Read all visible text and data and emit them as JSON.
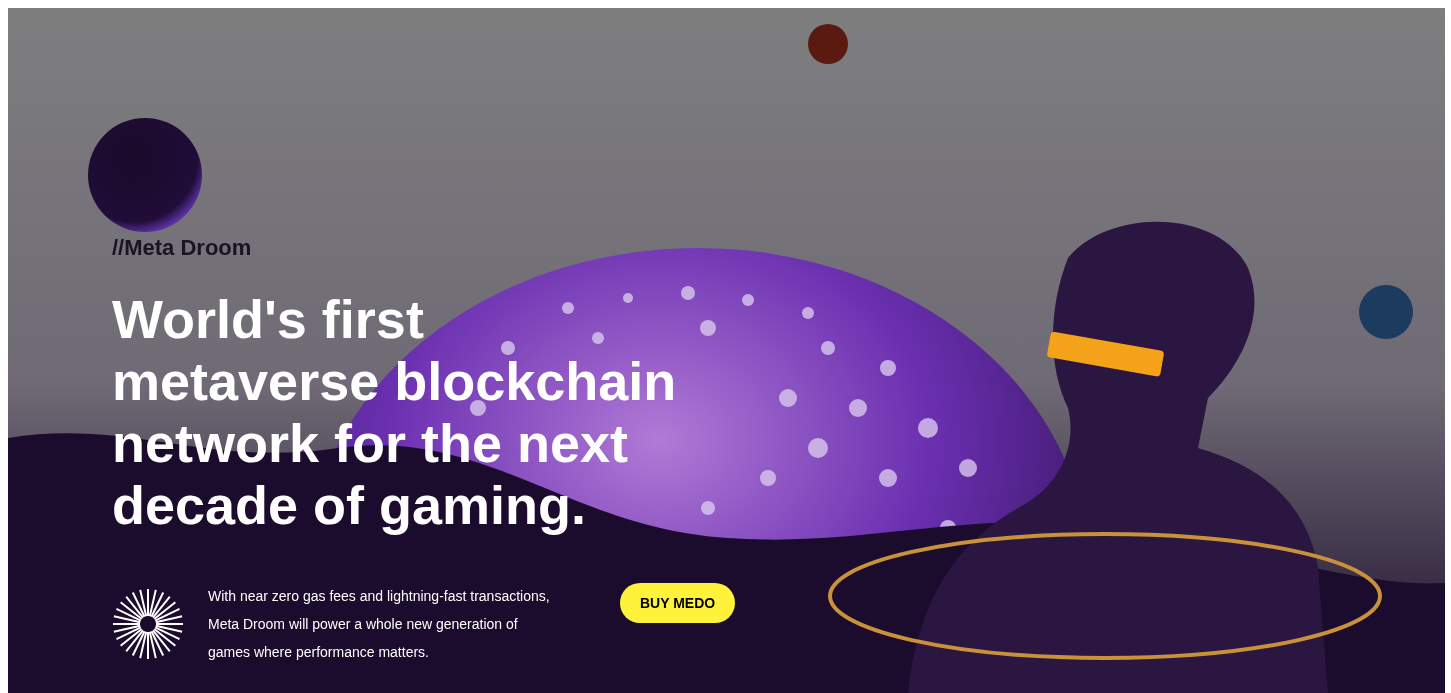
{
  "brand": {
    "mark": "//",
    "name": "Meta Droom"
  },
  "headline_lines": [
    "World's first",
    "metaverse blockchain",
    "network for the next",
    "decade of gaming."
  ],
  "description_lines": [
    "With near zero gas fees and lightning-fast transactions,",
    "Meta Droom will power a whole new generation of",
    "games where performance matters."
  ],
  "cta": {
    "label": "BUY MEDO"
  }
}
